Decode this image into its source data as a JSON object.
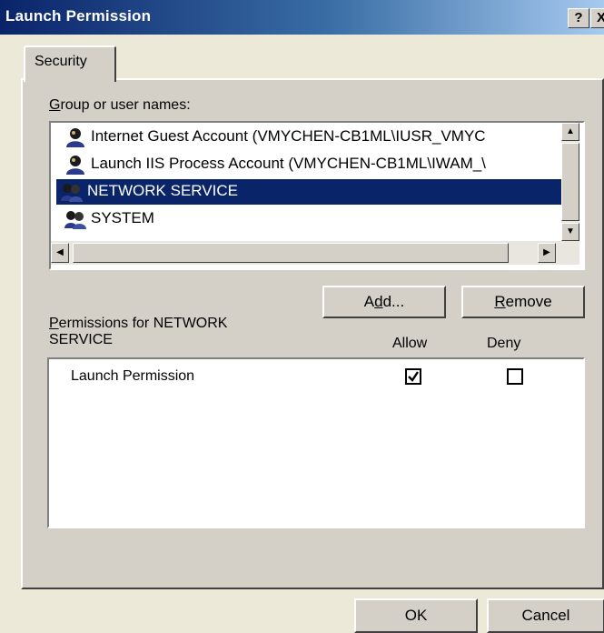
{
  "window": {
    "title": "Launch Permission",
    "help_glyph": "?",
    "close_glyph": "X"
  },
  "tabs": [
    {
      "label": "Security",
      "selected": true
    }
  ],
  "group_list": {
    "label_underline": "G",
    "label_rest": "roup or user names:",
    "items": [
      {
        "name": "Internet Guest Account (VMYCHEN-CB1ML\\IUSR_VMYC",
        "icon": "user-icon",
        "selected": false
      },
      {
        "name": "Launch IIS Process Account (VMYCHEN-CB1ML\\IWAM_\\",
        "icon": "user-icon",
        "selected": false
      },
      {
        "name": "NETWORK SERVICE",
        "icon": "group-icon",
        "selected": true
      },
      {
        "name": "SYSTEM",
        "icon": "group-icon",
        "selected": false
      }
    ]
  },
  "buttons": {
    "add_pre": "A",
    "add_u": "d",
    "add_post": "d...",
    "remove_u": "R",
    "remove_rest": "emove",
    "ok": "OK",
    "cancel": "Cancel"
  },
  "permissions": {
    "label_underline": "P",
    "label_line1_rest": "ermissions for NETWORK",
    "label_line2": "SERVICE",
    "col_allow": "Allow",
    "col_deny": "Deny",
    "rows": [
      {
        "name": "Launch Permission",
        "allow": true,
        "deny": false
      }
    ]
  },
  "colors": {
    "selection": "#0a246a",
    "dialog_face": "#d4d0c8"
  }
}
